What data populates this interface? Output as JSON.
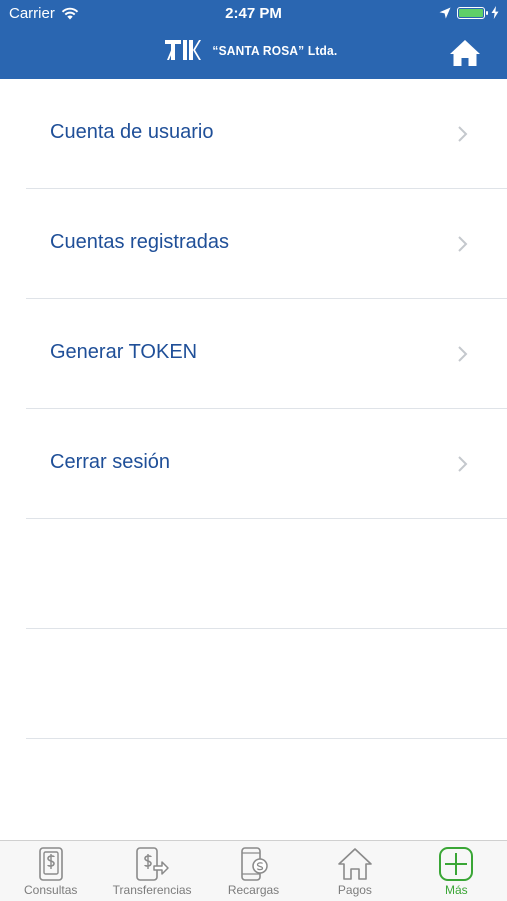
{
  "status_bar": {
    "carrier": "Carrier",
    "time": "2:47 PM"
  },
  "header": {
    "brand": "“SANTA ROSA” Ltda.",
    "home_icon": "home-icon",
    "color": "#2a66b1"
  },
  "menu": {
    "items": [
      {
        "label": "Cuenta de usuario"
      },
      {
        "label": "Cuentas registradas"
      },
      {
        "label": "Generar TOKEN"
      },
      {
        "label": "Cerrar sesión"
      }
    ]
  },
  "tabbar": {
    "tabs": [
      {
        "label": "Consultas",
        "icon": "phone-dollar-icon"
      },
      {
        "label": "Transferencias",
        "icon": "transfer-dollar-icon"
      },
      {
        "label": "Recargas",
        "icon": "mobile-recharge-icon"
      },
      {
        "label": "Pagos",
        "icon": "house-payment-icon"
      },
      {
        "label": "Más",
        "icon": "plus-icon",
        "active": true
      }
    ],
    "active_color": "#3aa636"
  }
}
